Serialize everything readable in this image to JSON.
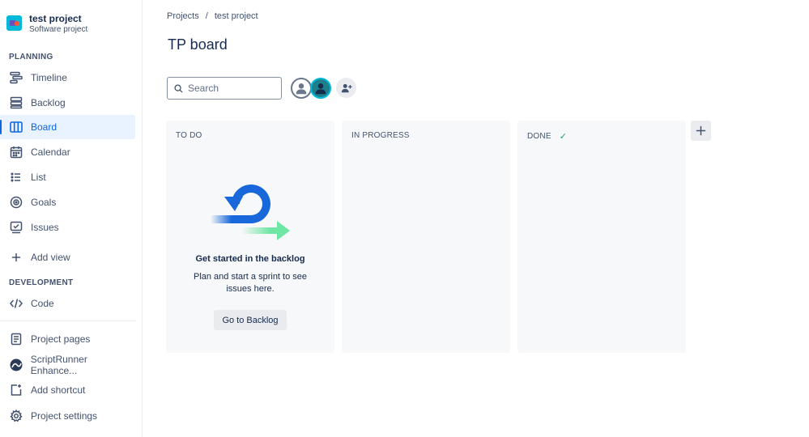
{
  "project": {
    "name": "test project",
    "type": "Software project"
  },
  "sidebar": {
    "planning_label": "PLANNING",
    "development_label": "DEVELOPMENT",
    "planning_items": [
      {
        "label": "Timeline",
        "icon": "timeline-icon"
      },
      {
        "label": "Backlog",
        "icon": "backlog-icon"
      },
      {
        "label": "Board",
        "icon": "board-icon",
        "active": true
      },
      {
        "label": "Calendar",
        "icon": "calendar-icon"
      },
      {
        "label": "List",
        "icon": "list-icon"
      },
      {
        "label": "Goals",
        "icon": "goals-icon"
      },
      {
        "label": "Issues",
        "icon": "issues-icon"
      },
      {
        "label": "Add view",
        "icon": "plus-icon"
      }
    ],
    "development_items": [
      {
        "label": "Code",
        "icon": "code-icon"
      }
    ],
    "bottom_items": [
      {
        "label": "Project pages",
        "icon": "page-icon"
      },
      {
        "label": "ScriptRunner Enhance...",
        "icon": "scriptrunner-icon"
      },
      {
        "label": "Add shortcut",
        "icon": "add-shortcut-icon"
      },
      {
        "label": "Project settings",
        "icon": "gear-icon"
      }
    ]
  },
  "breadcrumb": {
    "root": "Projects",
    "separator": "/",
    "current": "test project"
  },
  "board": {
    "title": "TP board",
    "search_placeholder": "Search",
    "columns": [
      {
        "title": "TO DO"
      },
      {
        "title": "IN PROGRESS"
      },
      {
        "title": "DONE",
        "done_check": "✓"
      }
    ],
    "empty_state": {
      "title": "Get started in the backlog",
      "description": "Plan and start a sprint to see issues here.",
      "button": "Go to Backlog"
    }
  },
  "colors": {
    "accent": "#0c66e4",
    "active_bg": "#e9f2ff",
    "done_check": "#22a06b"
  }
}
